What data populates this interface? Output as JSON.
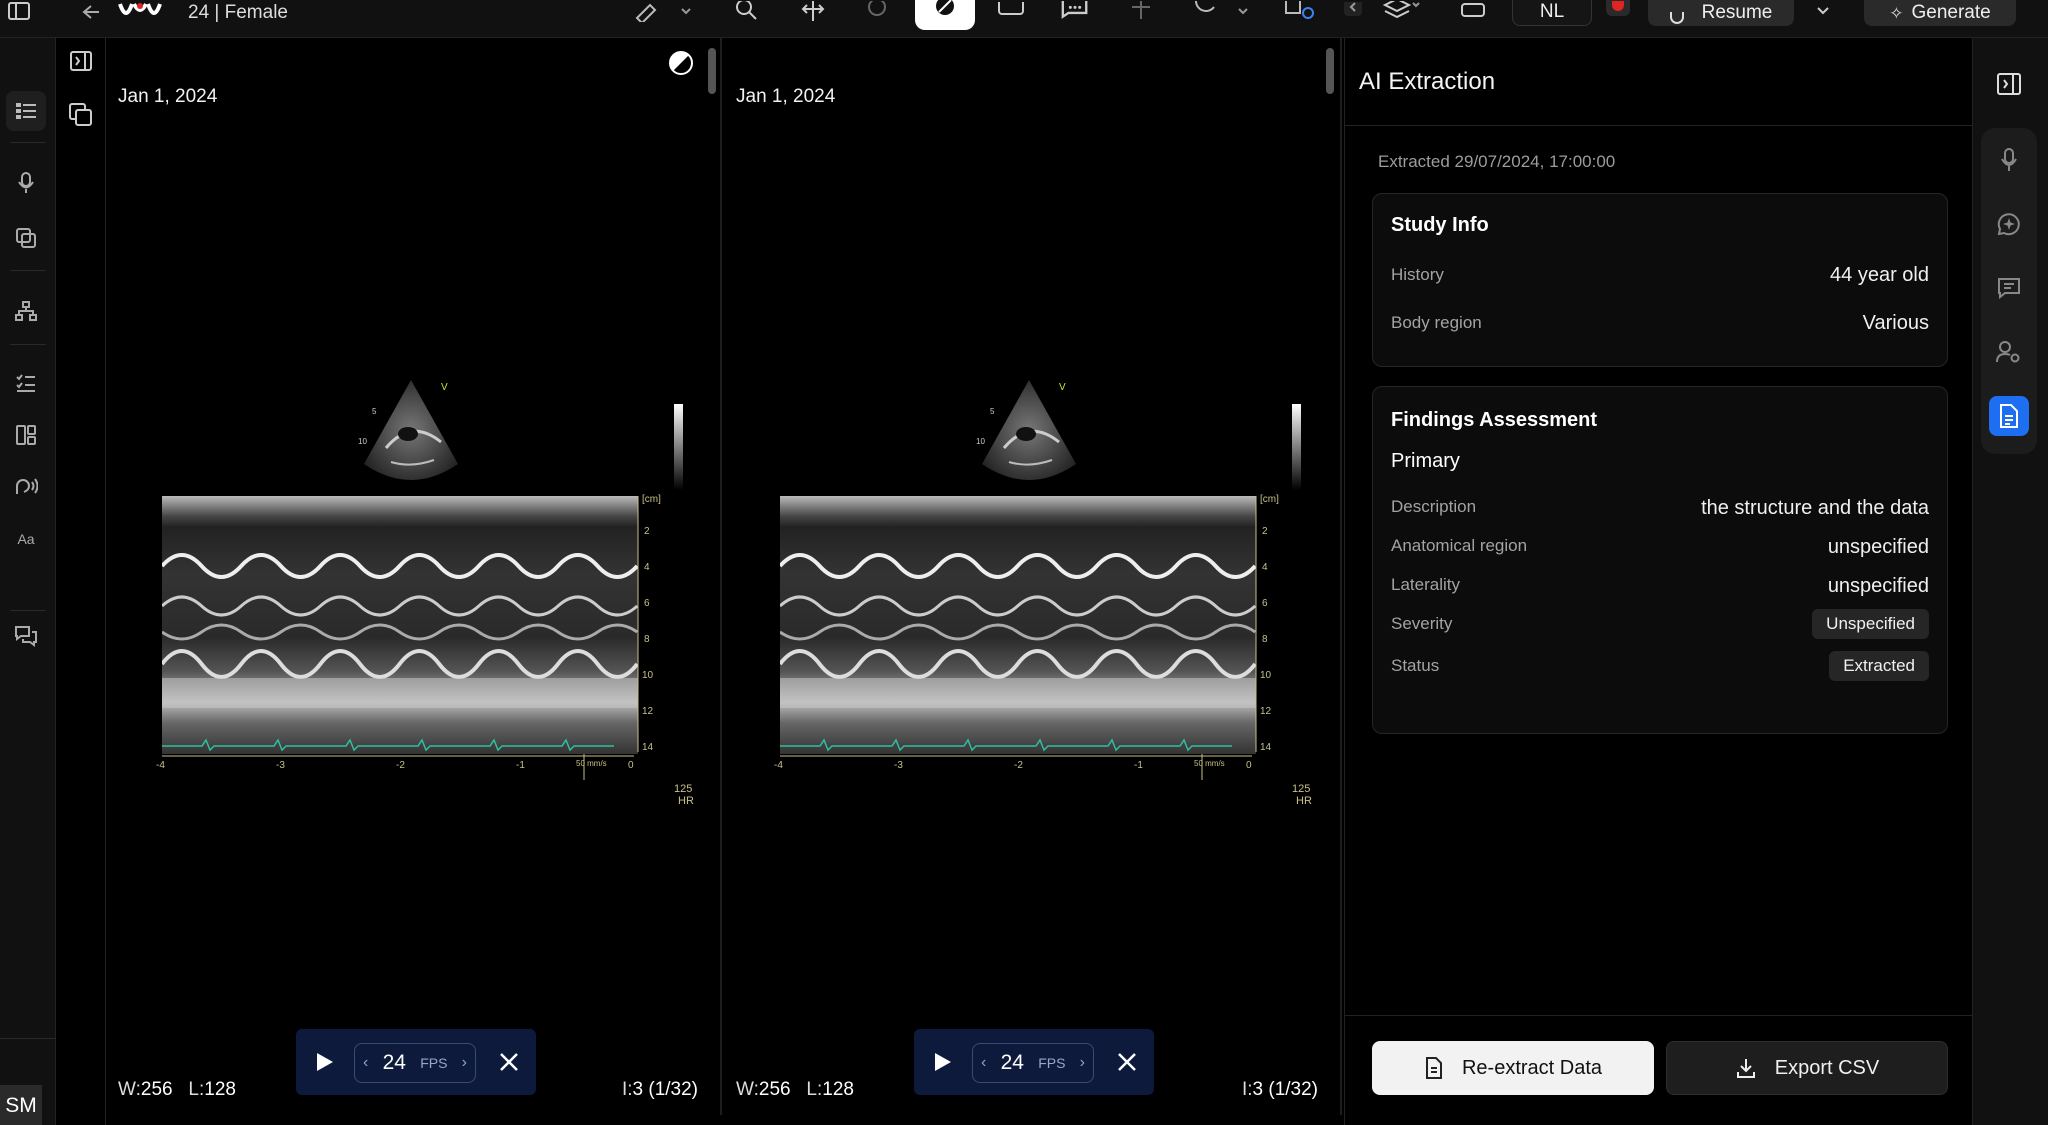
{
  "header": {
    "patient_info": "24 | Female",
    "language": "NL",
    "resume_label": "Resume",
    "generate_label": "Generate"
  },
  "viewports": [
    {
      "date": "Jan 1, 2024",
      "window_label": "W:",
      "window": "256",
      "level_label": "L:",
      "level": "128",
      "fps": "24",
      "fps_unit": "FPS",
      "image_label": "I:",
      "image_index": "3 (1/32)",
      "hr_value": "125",
      "hr_unit": "HR"
    },
    {
      "date": "Jan 1, 2024",
      "window_label": "W:",
      "window": "256",
      "level_label": "L:",
      "level": "128",
      "fps": "24",
      "fps_unit": "FPS",
      "image_label": "I:",
      "image_index": "3 (1/32)",
      "hr_value": "125",
      "hr_unit": "HR"
    }
  ],
  "ai_panel": {
    "title": "AI Extraction",
    "extracted": "Extracted 29/07/2024, 17:00:00",
    "study_info": {
      "title": "Study Info",
      "rows": [
        {
          "label": "History",
          "value": "44 year old"
        },
        {
          "label": "Body region",
          "value": "Various"
        }
      ]
    },
    "findings": {
      "title": "Findings Assessment",
      "subtitle": "Primary",
      "rows": [
        {
          "label": "Description",
          "value": "the structure and the data"
        },
        {
          "label": "Anatomical region",
          "value": "unspecified"
        },
        {
          "label": "Laterality",
          "value": "unspecified"
        }
      ],
      "severity_label": "Severity",
      "severity_value": "Unspecified",
      "status_label": "Status",
      "status_value": "Extracted"
    },
    "reextract_label": "Re-extract Data",
    "export_label": "Export CSV"
  },
  "user": {
    "initials": "SM"
  },
  "icons": {
    "left_rail": [
      "list-icon",
      "mic-icon",
      "copy-icon",
      "hierarchy-icon",
      "checklist-icon",
      "layout-icon",
      "voice-icon",
      "text-size-icon",
      "chat-icon"
    ],
    "right_rail": [
      "mic-icon",
      "ai-sparkle-icon",
      "comment-icon",
      "user-settings-icon",
      "document-icon"
    ]
  },
  "colors": {
    "accent": "#1d6ef0",
    "player_bg": "#0e1a3c",
    "record": "#e02424"
  }
}
